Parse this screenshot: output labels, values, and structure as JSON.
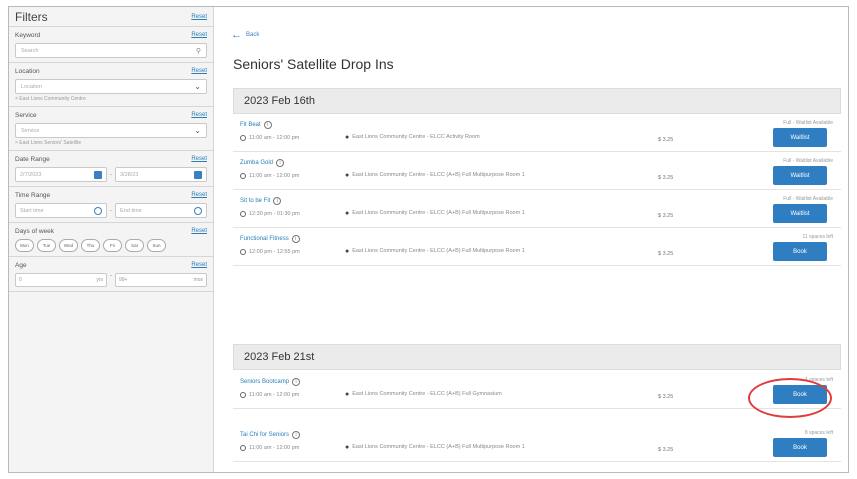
{
  "sidebar": {
    "title": "Filters",
    "reset_label": "Reset",
    "keyword": {
      "label": "Keyword",
      "placeholder": "Search"
    },
    "location": {
      "label": "Location",
      "value": "Location",
      "tag": "× East Lions Community Centre"
    },
    "service": {
      "label": "Service",
      "value": "Service",
      "tag": "× East Lions Seniors' Satellite"
    },
    "date_range": {
      "label": "Date Range",
      "from": "2/7/2023",
      "to": "3/28/23"
    },
    "time_range": {
      "label": "Time Range",
      "from": "Start time",
      "to": "End time"
    },
    "days": {
      "label": "Days of week",
      "items": [
        "Mon",
        "Tue",
        "Wed",
        "Thu",
        "Fri",
        "Sat",
        "Sun"
      ]
    },
    "age": {
      "label": "Age",
      "min": "0",
      "min_unit": "yrs",
      "max": "99+",
      "max_unit": "mos"
    }
  },
  "main": {
    "back_label": "Back",
    "title": "Seniors' Satellite Drop Ins",
    "groups": [
      {
        "date": "2023 Feb 16th",
        "sessions": [
          {
            "name": "Fit Beat",
            "time": "11:00 am - 12:00 pm",
            "location": "East Lions Community Centre - ELCC Activity Room",
            "price": "$ 3.25",
            "availability": "Full - Waitlist Available",
            "button": "Waitlist"
          },
          {
            "name": "Zumba Gold",
            "time": "11:00 am - 12:00 pm",
            "location": "East Lions Community Centre - ELCC (A+B) Full Multipurpose Room 1",
            "price": "$ 3.25",
            "availability": "Full - Waitlist Available",
            "button": "Waitlist"
          },
          {
            "name": "Sit to be Fit",
            "time": "12:30 pm - 01:30 pm",
            "location": "East Lions Community Centre - ELCC (A+B) Full Multipurpose Room 1",
            "price": "$ 3.25",
            "availability": "Full - Waitlist Available",
            "button": "Waitlist"
          },
          {
            "name": "Functional Fitness",
            "time": "12:00 pm - 12:55 pm",
            "location": "East Lions Community Centre - ELCC (A+B) Full Multipurpose Room 1",
            "price": "$ 3.25",
            "availability": "11 spaces left",
            "button": "Book"
          }
        ]
      },
      {
        "date": "2023 Feb 21st",
        "sessions": [
          {
            "name": "Seniors Bootcamp",
            "time": "11:00 am - 12:00 pm",
            "location": "East Lions Community Centre - ELCC (A+B) Full Gymnasium",
            "price": "$ 3.25",
            "availability": "4 spaces left",
            "button": "Book"
          },
          {
            "name": "Tai Chi for Seniors",
            "time": "11:00 am - 12:00 pm",
            "location": "East Lions Community Centre - ELCC (A+B) Full Multipurpose Room 1",
            "price": "$ 3.25",
            "availability": "8 spaces left",
            "button": "Book"
          }
        ]
      }
    ]
  },
  "colors": {
    "accent": "#2f7ec1",
    "highlight": "#e23b3b",
    "sidebar_bg": "#f4f4f4"
  }
}
